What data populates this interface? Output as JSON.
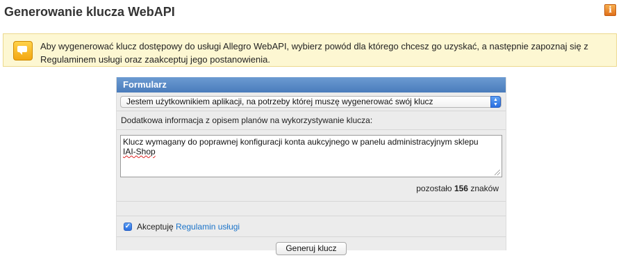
{
  "page": {
    "title": "Generowanie klucza WebAPI",
    "info_icon_glyph": "i"
  },
  "notice": {
    "icon": "speech-bubble-icon",
    "text": "Aby wygenerować klucz dostępowy do usługi Allegro WebAPI, wybierz powód dla którego chcesz go uzyskać, a następnie zapoznaj się z Regulaminem usługi oraz zaakceptuj jego postanowienia."
  },
  "form": {
    "header": "Formularz",
    "reason_selected": "Jestem użytkownikiem aplikacji, na potrzeby której muszę wygenerować swój klucz",
    "info_label": "Dodatkowa informacja z opisem planów na wykorzystywanie klucza:",
    "textarea_line1": "Klucz wymagany do poprawnej konfiguracji konta aukcyjnego w panelu administracyjnym sklepu",
    "textarea_line2": "IAI-Shop",
    "counter_prefix": "pozostało",
    "counter_value": "156",
    "counter_suffix": "znaków",
    "accept_checked": true,
    "accept_label": "Akceptuję",
    "accept_link": "Regulamin usługi",
    "submit_label": "Generuj klucz"
  },
  "colors": {
    "header_blue": "#4a7cbc",
    "notice_bg": "#fdf7d2",
    "link": "#1a73c9",
    "info_icon": "#e0701a"
  }
}
